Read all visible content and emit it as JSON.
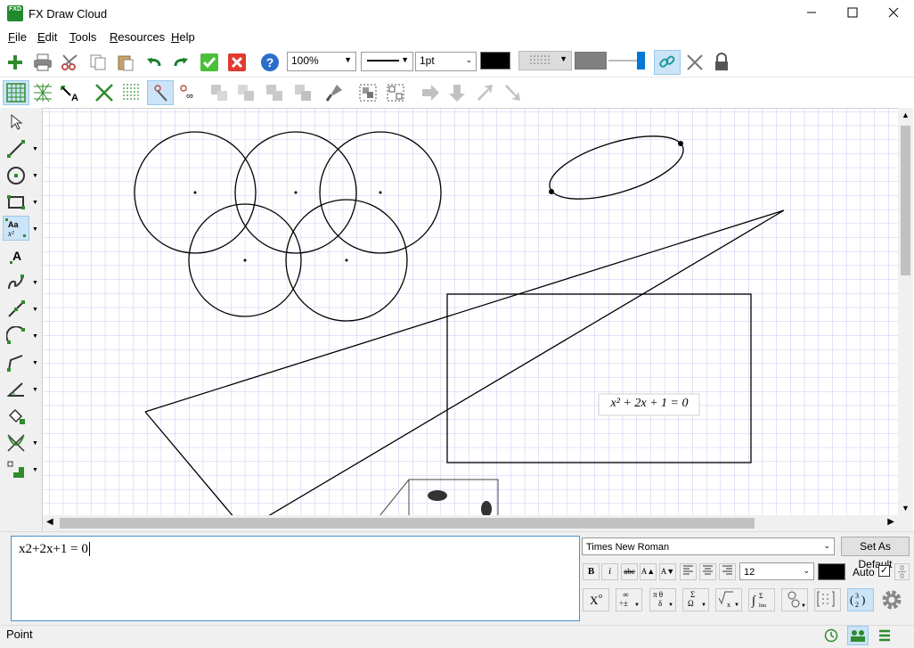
{
  "window": {
    "title": "FX Draw Cloud",
    "icon_text": "FXD",
    "controls": [
      "minimize-icon",
      "maximize-icon",
      "close-icon"
    ]
  },
  "menu": [
    "File",
    "Edit",
    "Tools",
    "Resources",
    "Help"
  ],
  "toolbar1": {
    "zoom": "100%",
    "line_style": "solid",
    "line_weight": "1pt",
    "line_color": "#000000",
    "fill_color": "#808080"
  },
  "canvas": {
    "equation_label": "x² + 2x + 1 = 0",
    "grid_color": "#b8b8f0"
  },
  "editor": {
    "equation_source": "x2+2x+1 = 0",
    "font": "Times New Roman",
    "set_default_label": "Set As Default",
    "font_size": "12",
    "text_color": "#000000",
    "auto_label": "Auto",
    "auto_checked": "✓",
    "format_buttons": [
      "B",
      "i",
      "abc",
      "A▲",
      "A▼"
    ]
  },
  "status": {
    "text": "Point"
  },
  "colors": {
    "accent": "#0078d7",
    "green_tool": "#2e8b2e",
    "panel_bg": "#f0f0f0"
  }
}
